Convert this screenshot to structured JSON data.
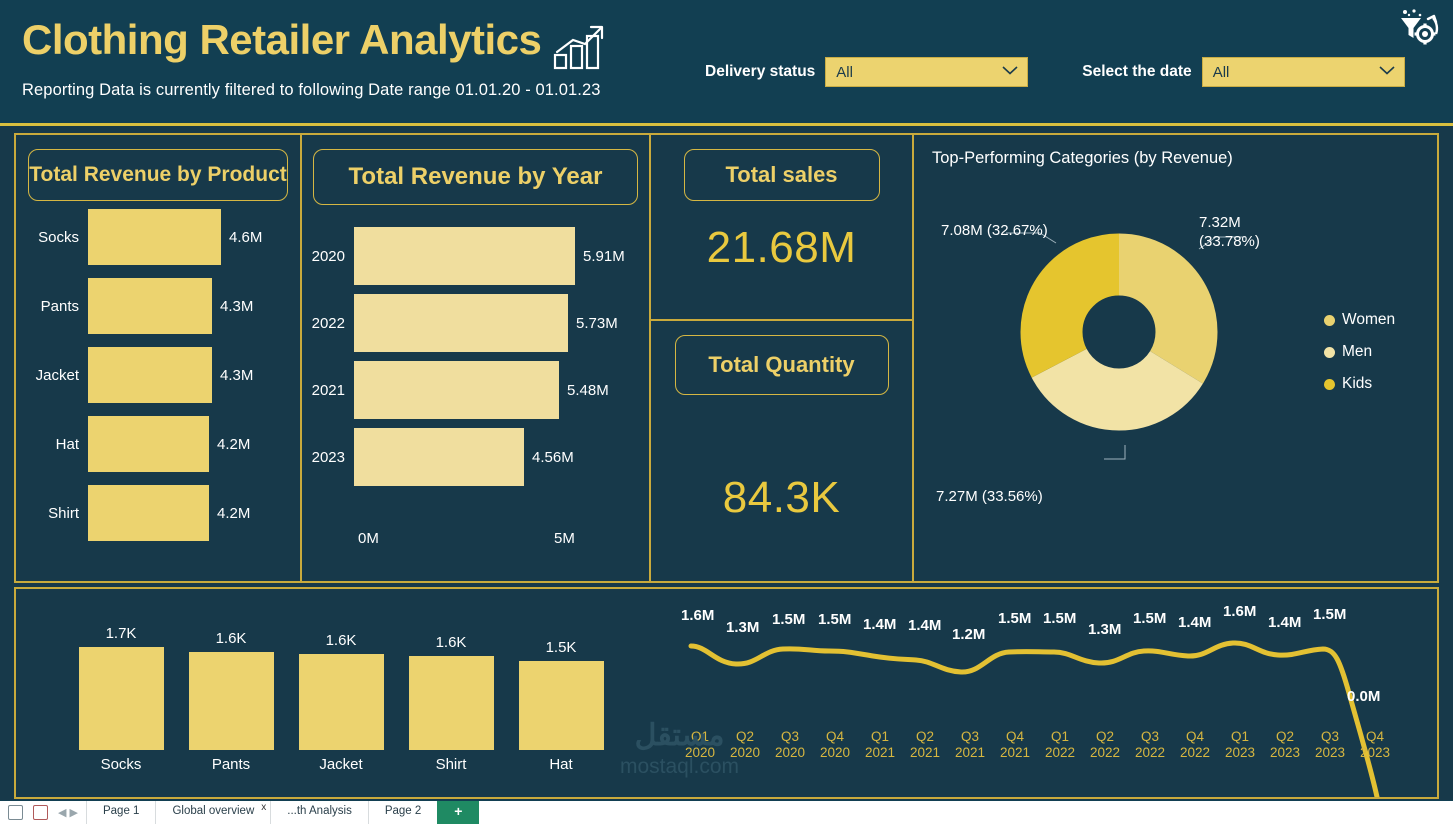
{
  "header": {
    "title": "Clothing Retailer Analytics",
    "title_icon": "growth-chart-icon",
    "subtitle": "Reporting Data is currently filtered to following  Date range 01.01.20  - 01.01.23",
    "refresh_icon": "filter-gear-refresh-icon",
    "filters": [
      {
        "label": "Delivery status",
        "value": "All",
        "icon": "chevron-down-icon"
      },
      {
        "label": "Select the date",
        "value": "All",
        "icon": "chevron-down-icon"
      }
    ]
  },
  "panels": {
    "product_revenue_title": "Total Revenue by Product",
    "year_revenue_title": "Total Revenue by Year",
    "total_sales_title": "Total sales",
    "total_sales_value": "21.68M",
    "total_quantity_title": "Total Quantity",
    "total_quantity_value": "84.3K",
    "donut_title": "Top-Performing Categories (by Revenue)"
  },
  "colors": {
    "background": "#17394a",
    "header_bg": "#123f52",
    "accent_gold": "#d9bf3f",
    "title_gold": "#edd068",
    "bar_gold": "#ecd36f",
    "bar_light": "#f0de9e",
    "kpi_gold": "#e9c93f",
    "donut_women": "#e9d270",
    "donut_men": "#f2e3a6",
    "donut_kids": "#e5c52e",
    "line_gold": "#e3c133",
    "text_white": "#ffffff"
  },
  "watermark": {
    "arabic": "مستقل",
    "english": "mostaql.com"
  },
  "taskbar": {
    "tabs": [
      "Page 1",
      "Global overview",
      "...th Analysis",
      "Page 2"
    ],
    "add_label": "+",
    "close_label": "x"
  },
  "chart_data": [
    {
      "type": "bar",
      "orientation": "horizontal",
      "title": "Total Revenue by Product",
      "categories": [
        "Socks",
        "Pants",
        "Jacket",
        "Hat",
        "Shirt"
      ],
      "values": [
        4.6,
        4.3,
        4.3,
        4.2,
        4.2
      ],
      "labels": [
        "4.6M",
        "4.3M",
        "4.3M",
        "4.2M",
        "4.2M"
      ],
      "xlabel": "",
      "ylabel": "",
      "unit": "M",
      "grid": false,
      "legend": "none"
    },
    {
      "type": "bar",
      "orientation": "horizontal",
      "title": "Total Revenue by Year",
      "categories": [
        "2020",
        "2022",
        "2021",
        "2023"
      ],
      "values": [
        5.91,
        5.73,
        5.48,
        4.56
      ],
      "labels": [
        "5.91M",
        "5.73M",
        "5.48M",
        "4.56M"
      ],
      "axis_ticks": [
        "0M",
        "5M"
      ],
      "xlim": [
        0,
        6.2
      ],
      "xlabel": "",
      "ylabel": "",
      "unit": "M",
      "grid": false,
      "legend": "none"
    },
    {
      "type": "pie",
      "subtype": "donut",
      "title": "Top-Performing Categories (by Revenue)",
      "categories": [
        "Women",
        "Men",
        "Kids"
      ],
      "values": [
        7.32,
        7.27,
        7.08
      ],
      "percents": [
        33.78,
        33.56,
        32.67
      ],
      "labels": [
        "7.32M\n(33.78%)",
        "7.27M (33.56%)",
        "7.08M (32.67%)"
      ],
      "colors": [
        "#e9d270",
        "#f2e3a6",
        "#e5c52e"
      ],
      "legend": "right"
    },
    {
      "type": "bar",
      "orientation": "vertical",
      "title": "",
      "categories": [
        "Socks",
        "Pants",
        "Jacket",
        "Shirt",
        "Hat"
      ],
      "values": [
        1.7,
        1.6,
        1.6,
        1.6,
        1.5
      ],
      "labels": [
        "1.7K",
        "1.6K",
        "1.6K",
        "1.6K",
        "1.5K"
      ],
      "unit": "K",
      "grid": false,
      "legend": "none"
    },
    {
      "type": "line",
      "title": "",
      "categories": [
        "Q1 2020",
        "Q2 2020",
        "Q3 2020",
        "Q4 2020",
        "Q1 2021",
        "Q2 2021",
        "Q3 2021",
        "Q4 2021",
        "Q1 2022",
        "Q2 2022",
        "Q3 2022",
        "Q4 2022",
        "Q1 2023",
        "Q2 2023",
        "Q3 2023",
        "Q4 2023"
      ],
      "tick_lines": [
        [
          "Q1",
          "2020"
        ],
        [
          "Q2",
          "2020"
        ],
        [
          "Q3",
          "2020"
        ],
        [
          "Q4",
          "2020"
        ],
        [
          "Q1",
          "2021"
        ],
        [
          "Q2",
          "2021"
        ],
        [
          "Q3",
          "2021"
        ],
        [
          "Q4",
          "2021"
        ],
        [
          "Q1",
          "2022"
        ],
        [
          "Q2",
          "2022"
        ],
        [
          "Q3",
          "2022"
        ],
        [
          "Q4",
          "2022"
        ],
        [
          "Q1",
          "2023"
        ],
        [
          "Q2",
          "2023"
        ],
        [
          "Q3",
          "2023"
        ],
        [
          "Q4",
          "2023"
        ]
      ],
      "values": [
        1.6,
        1.3,
        1.5,
        1.5,
        1.4,
        1.4,
        1.2,
        1.5,
        1.5,
        1.3,
        1.5,
        1.4,
        1.6,
        1.4,
        1.5,
        0.0
      ],
      "labels": [
        "1.6M",
        "1.3M",
        "1.5M",
        "1.5M",
        "1.4M",
        "1.4M",
        "1.2M",
        "1.5M",
        "1.5M",
        "1.3M",
        "1.5M",
        "1.4M",
        "1.6M",
        "1.4M",
        "1.5M",
        "0.0M"
      ],
      "ylim": [
        0,
        1.8
      ],
      "unit": "M",
      "grid": false,
      "legend": "none",
      "color": "#e3c133"
    }
  ]
}
